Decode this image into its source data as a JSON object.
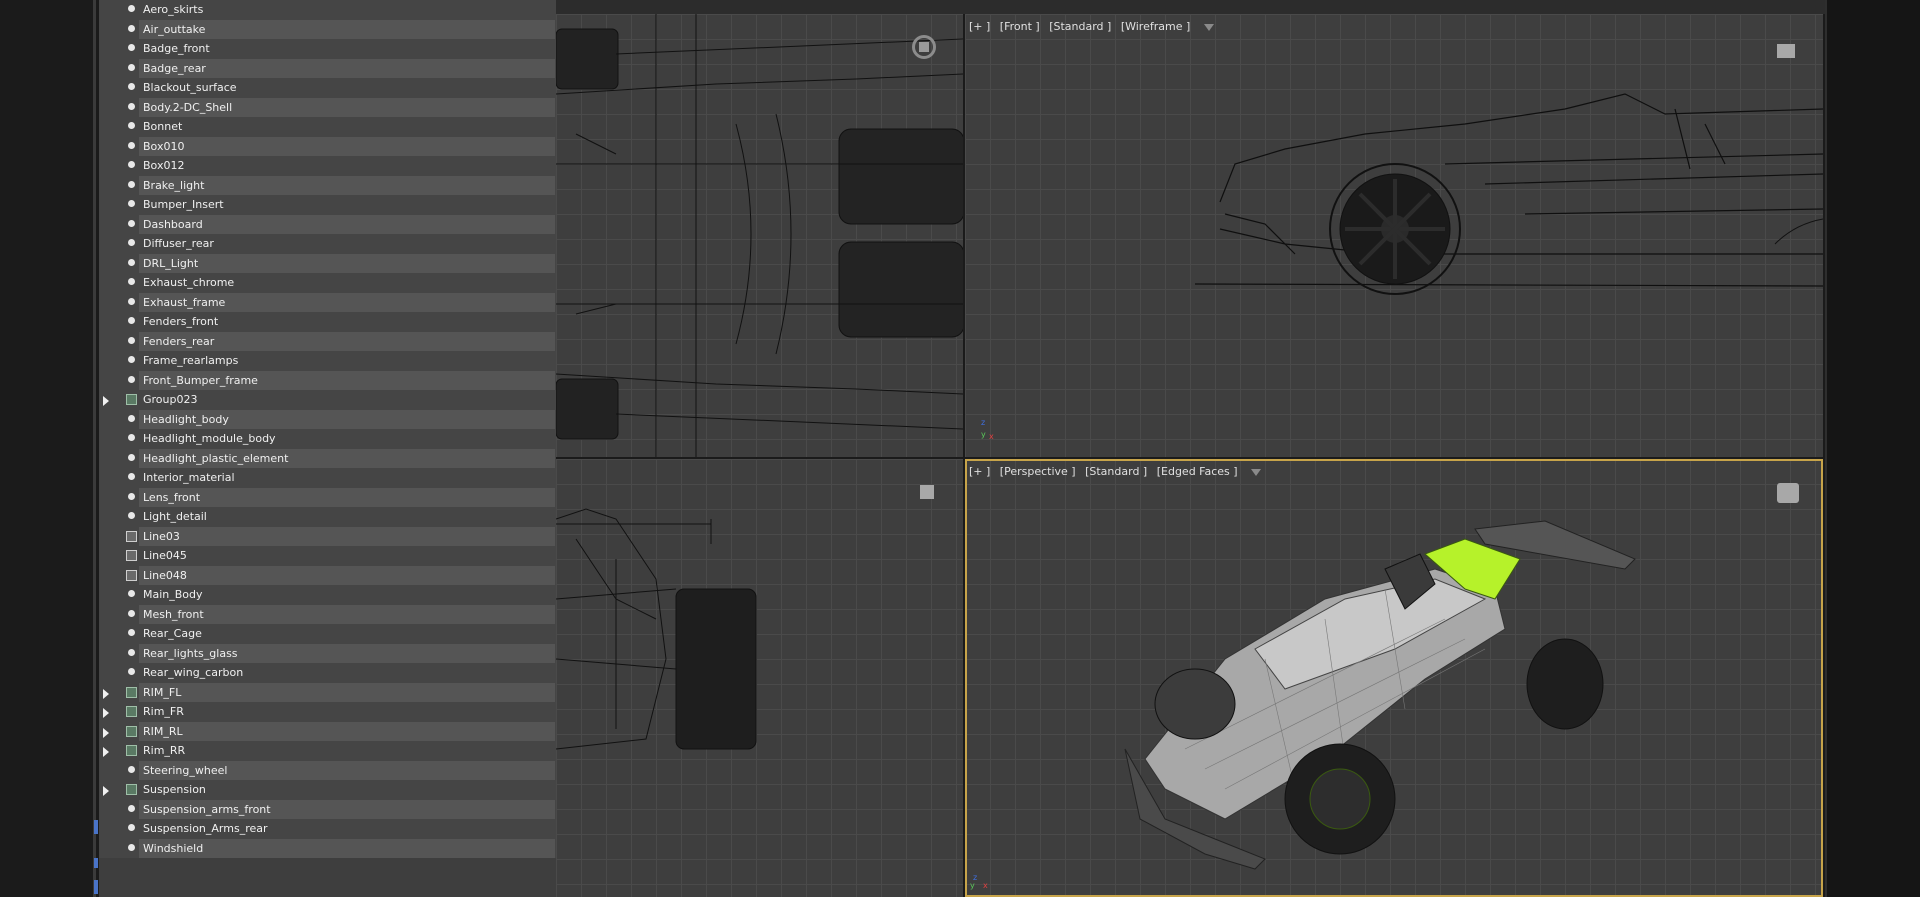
{
  "viewports": {
    "front": {
      "plus": "[+ ]",
      "view": "[Front ]",
      "shading": "[Standard ]",
      "mode": "[Wireframe ]"
    },
    "perspective": {
      "plus": "[+ ]",
      "view": "[Perspective ]",
      "shading": "[Standard ]",
      "mode": "[Edged Faces ]"
    },
    "axis_z": "z",
    "axis_y": "y",
    "axis_x": "x"
  },
  "scene_explorer": {
    "items": [
      {
        "label": "Aero_skirts",
        "type": "object"
      },
      {
        "label": "Air_outtake",
        "type": "object"
      },
      {
        "label": "Badge_front",
        "type": "object"
      },
      {
        "label": "Badge_rear",
        "type": "object"
      },
      {
        "label": "Blackout_surface",
        "type": "object"
      },
      {
        "label": "Body.2-DC_Shell",
        "type": "object"
      },
      {
        "label": "Bonnet",
        "type": "object"
      },
      {
        "label": "Box010",
        "type": "object"
      },
      {
        "label": "Box012",
        "type": "object"
      },
      {
        "label": "Brake_light",
        "type": "object"
      },
      {
        "label": "Bumper_Insert",
        "type": "object"
      },
      {
        "label": "Dashboard",
        "type": "object"
      },
      {
        "label": "Diffuser_rear",
        "type": "object"
      },
      {
        "label": "DRL_Light",
        "type": "object"
      },
      {
        "label": "Exhaust_chrome",
        "type": "object"
      },
      {
        "label": "Exhaust_frame",
        "type": "object"
      },
      {
        "label": "Fenders_front",
        "type": "object"
      },
      {
        "label": "Fenders_rear",
        "type": "object"
      },
      {
        "label": "Frame_rearlamps",
        "type": "object"
      },
      {
        "label": "Front_Bumper_frame",
        "type": "object"
      },
      {
        "label": "Group023",
        "type": "group"
      },
      {
        "label": "Headlight_body",
        "type": "object"
      },
      {
        "label": "Headlight_module_body",
        "type": "object"
      },
      {
        "label": "Headlight_plastic_element",
        "type": "object"
      },
      {
        "label": "Interior_material",
        "type": "object"
      },
      {
        "label": "Lens_front",
        "type": "object"
      },
      {
        "label": "Light_detail",
        "type": "object"
      },
      {
        "label": "Line03",
        "type": "shape"
      },
      {
        "label": "Line045",
        "type": "shape"
      },
      {
        "label": "Line048",
        "type": "shape"
      },
      {
        "label": "Main_Body",
        "type": "object"
      },
      {
        "label": "Mesh_front",
        "type": "object"
      },
      {
        "label": "Rear_Cage",
        "type": "object"
      },
      {
        "label": "Rear_lights_glass",
        "type": "object"
      },
      {
        "label": "Rear_wing_carbon",
        "type": "object"
      },
      {
        "label": "RIM_FL",
        "type": "group"
      },
      {
        "label": "Rim_FR",
        "type": "group"
      },
      {
        "label": "RIM_RL",
        "type": "group"
      },
      {
        "label": "Rim_RR",
        "type": "group"
      },
      {
        "label": "Steering_wheel",
        "type": "object"
      },
      {
        "label": "Suspension",
        "type": "group"
      },
      {
        "label": "Suspension_arms_front",
        "type": "object"
      },
      {
        "label": "Suspension_Arms_rear",
        "type": "object"
      },
      {
        "label": "Windshield",
        "type": "object"
      }
    ]
  },
  "colors": {
    "active_viewport_border": "#c7a44a",
    "highlight_green": "#b6f22a"
  }
}
